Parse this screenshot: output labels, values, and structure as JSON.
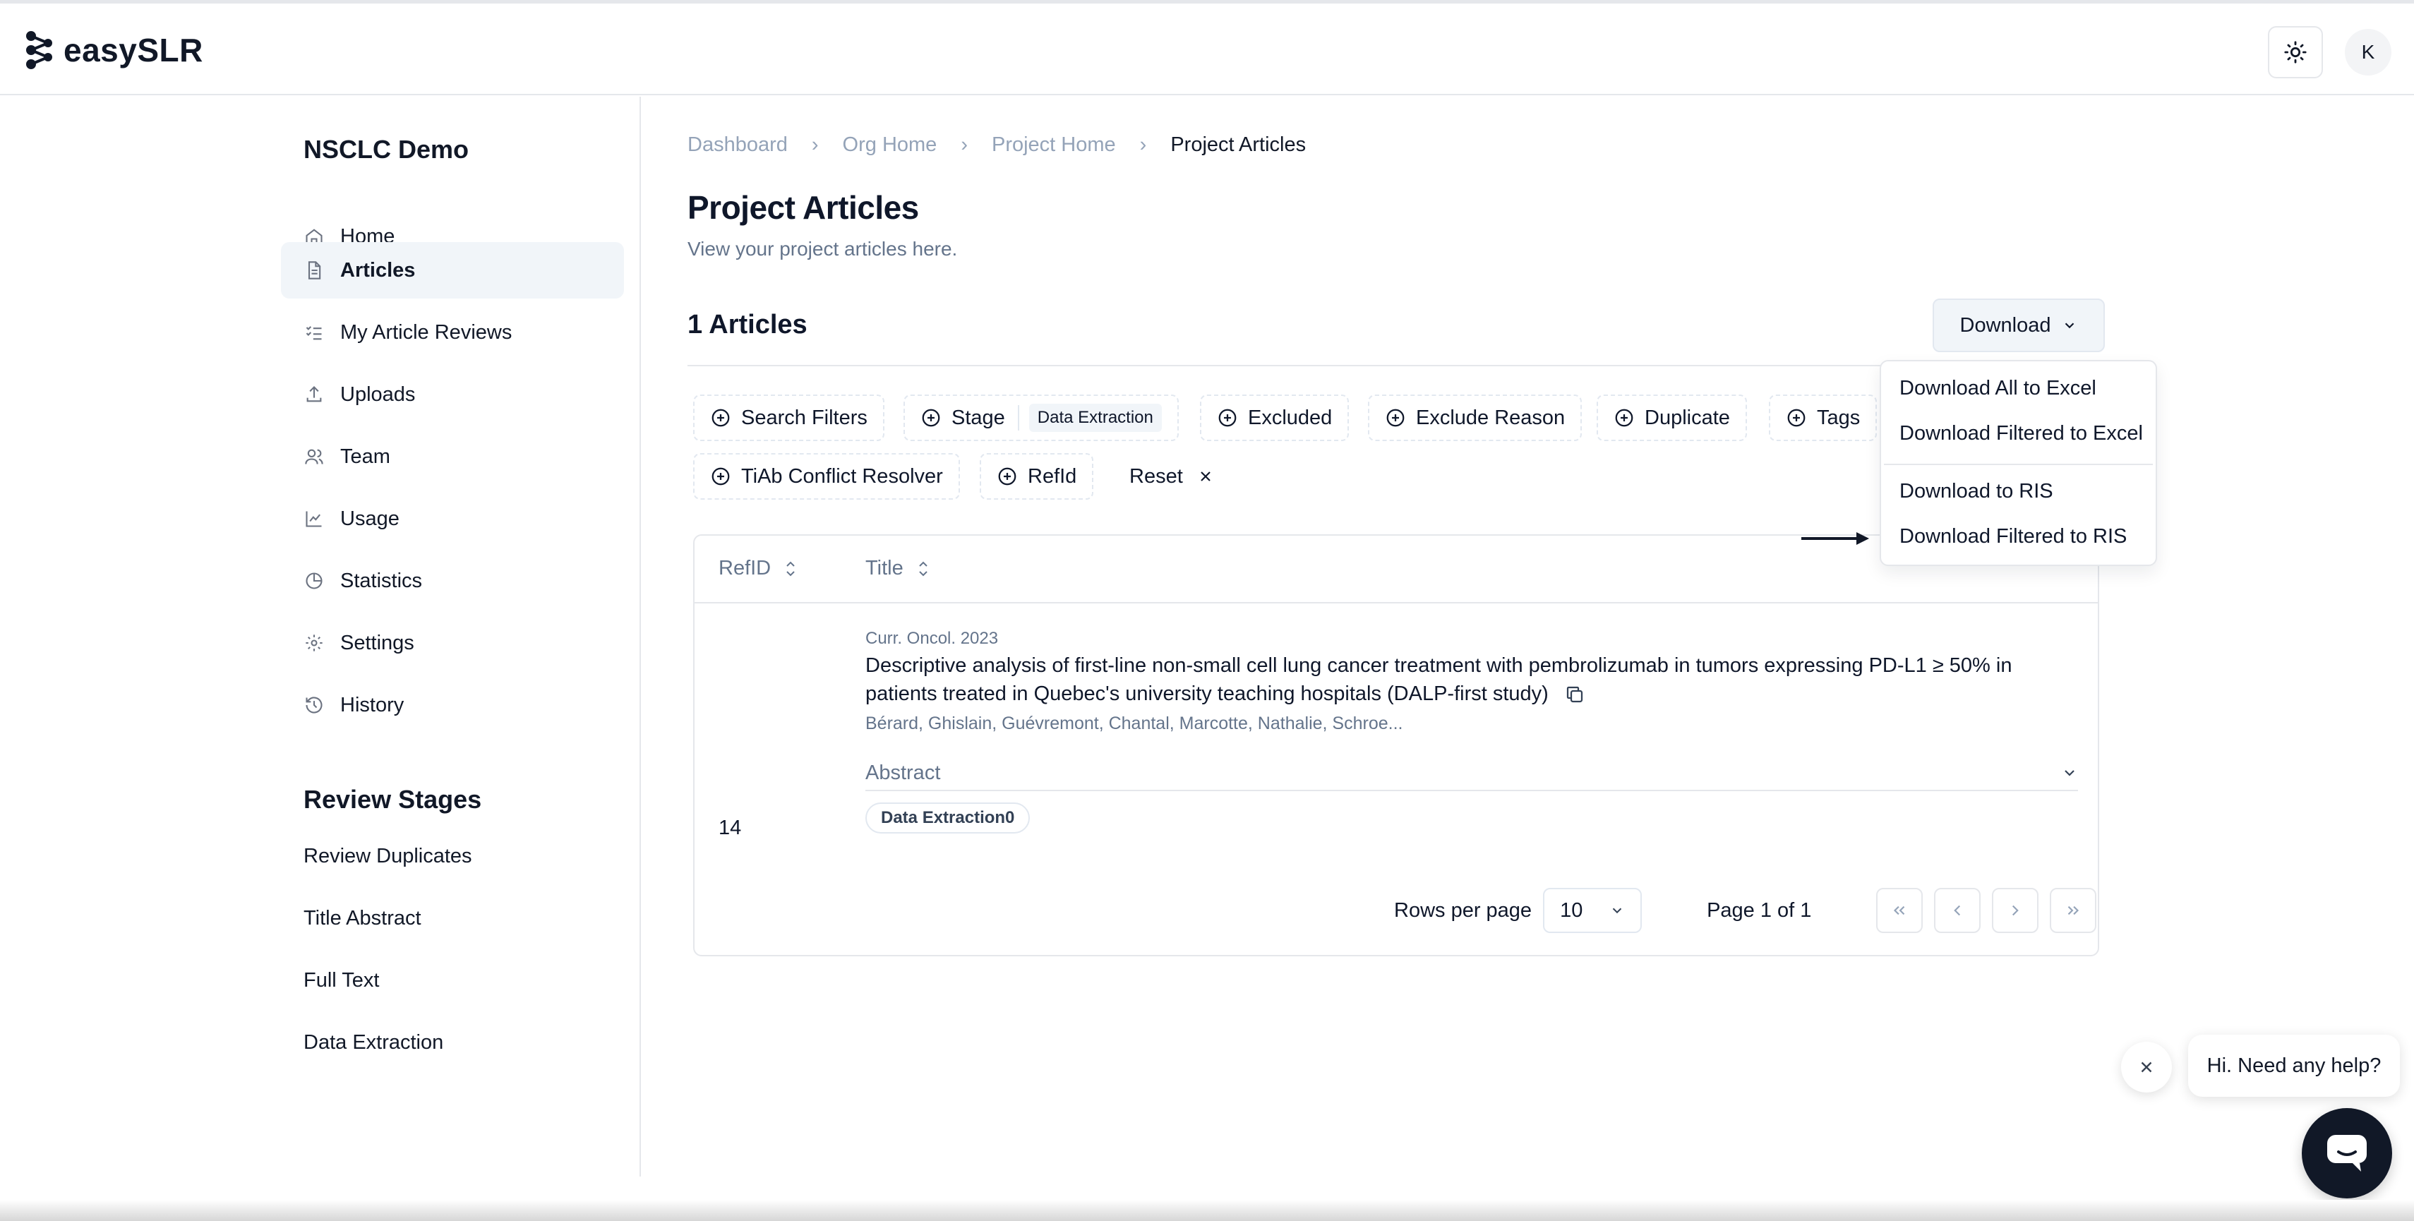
{
  "app": {
    "logo_text": "easySLR",
    "avatar_initial": "K"
  },
  "sidebar": {
    "project_name": "NSCLC Demo",
    "items": [
      {
        "label": "Home",
        "icon": "home-icon"
      },
      {
        "label": "Articles",
        "icon": "document-icon",
        "active": true
      },
      {
        "label": "My Article Reviews",
        "icon": "checklist-icon"
      },
      {
        "label": "Uploads",
        "icon": "upload-icon"
      },
      {
        "label": "Team",
        "icon": "users-icon"
      },
      {
        "label": "Usage",
        "icon": "line-chart-icon"
      },
      {
        "label": "Statistics",
        "icon": "pie-chart-icon"
      },
      {
        "label": "Settings",
        "icon": "gear-icon"
      },
      {
        "label": "History",
        "icon": "history-icon"
      }
    ],
    "review_stages_title": "Review Stages",
    "stages": [
      "Review Duplicates",
      "Title Abstract",
      "Full Text",
      "Data Extraction"
    ]
  },
  "breadcrumb": [
    "Dashboard",
    "Org Home",
    "Project Home",
    "Project Articles"
  ],
  "page": {
    "title": "Project Articles",
    "subtitle": "View your project articles here.",
    "count_label": "1 Articles",
    "download_label": "Download"
  },
  "filters": {
    "search": "Search Filters",
    "stage": "Stage",
    "stage_value": "Data Extraction",
    "excluded": "Excluded",
    "exclude_reason": "Exclude Reason",
    "duplicate": "Duplicate",
    "tags": "Tags",
    "tiab_conflict": "TiAb Conflict Resolver",
    "refid": "RefId",
    "reset": "Reset"
  },
  "table": {
    "headers": {
      "refid": "RefID",
      "title": "Title"
    },
    "rows": [
      {
        "refid": "14",
        "journal": "Curr. Oncol. 2023",
        "title": "Descriptive analysis of first-line non-small cell lung cancer treatment with pembrolizumab in tumors expressing PD-L1 ≥ 50% in patients treated in Quebec's university teaching hospitals (DALP-first study)",
        "authors": "Bérard, Ghislain, Guévremont, Chantal, Marcotte, Nathalie, Schroe...",
        "abstract_label": "Abstract",
        "stage_badge": "Data Extraction0"
      }
    ]
  },
  "pagination": {
    "rows_per_page_label": "Rows per page",
    "rows_per_page_value": "10",
    "page_label": "Page 1 of 1"
  },
  "download_menu": {
    "items": [
      "Download All to Excel",
      "Download Filtered to Excel",
      "Download to RIS",
      "Download Filtered to RIS"
    ]
  },
  "help": {
    "bubble_text": "Hi. Need any help?"
  },
  "colors": {
    "accent_bg": "#f1f5f9",
    "text": "#0f172a",
    "muted": "#64748b",
    "chat": "#111827"
  }
}
